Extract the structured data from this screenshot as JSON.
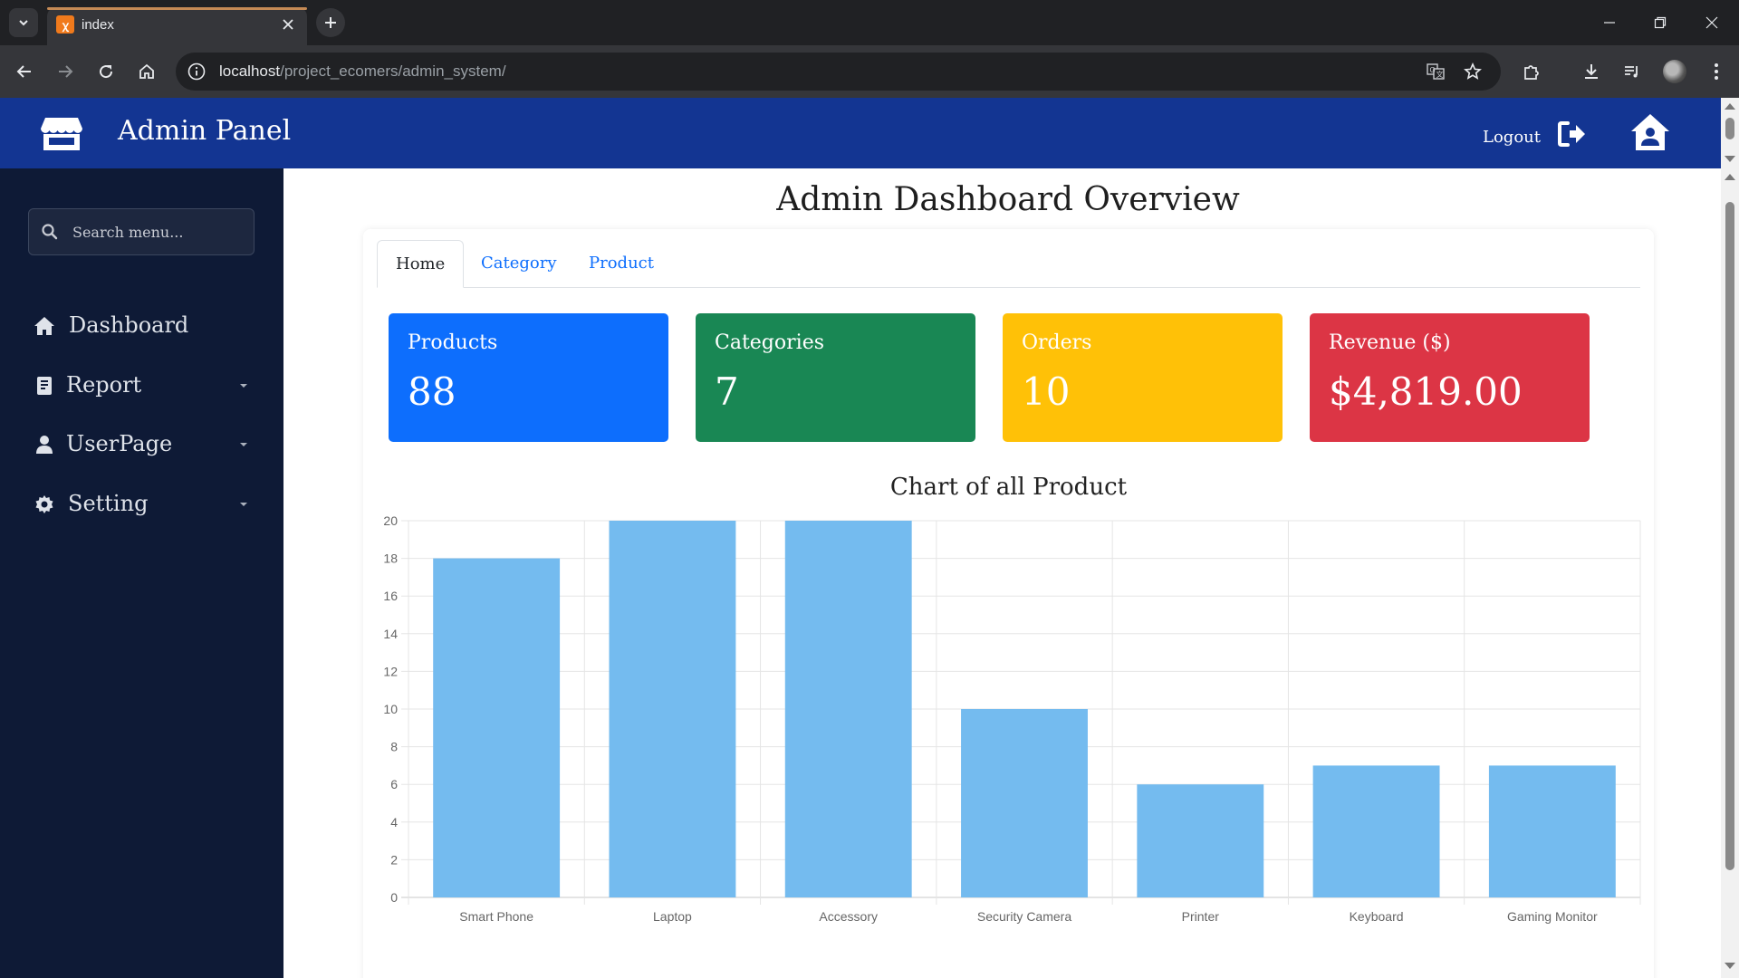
{
  "browser": {
    "tab_title": "index",
    "url_host": "localhost",
    "url_path": "/project_ecomers/admin_system/"
  },
  "header": {
    "brand": "Admin Panel",
    "logout_label": "Logout"
  },
  "sidebar": {
    "search_placeholder": "Search menu...",
    "items": [
      {
        "label": "Dashboard",
        "icon": "home-icon",
        "has_submenu": false
      },
      {
        "label": "Report",
        "icon": "report-icon",
        "has_submenu": true
      },
      {
        "label": "UserPage",
        "icon": "user-icon",
        "has_submenu": true
      },
      {
        "label": "Setting",
        "icon": "gear-icon",
        "has_submenu": true
      }
    ]
  },
  "main": {
    "title": "Admin Dashboard Overview",
    "tabs": [
      {
        "label": "Home",
        "active": true
      },
      {
        "label": "Category",
        "active": false
      },
      {
        "label": "Product",
        "active": false
      }
    ],
    "stats": [
      {
        "label": "Products",
        "value": "88",
        "color": "#0d6efd"
      },
      {
        "label": "Categories",
        "value": "7",
        "color": "#198754"
      },
      {
        "label": "Orders",
        "value": "10",
        "color": "#ffc107"
      },
      {
        "label": "Revenue ($)",
        "value": "$4,819.00",
        "color": "#dc3545"
      }
    ]
  },
  "chart_data": {
    "type": "bar",
    "title": "Chart of all Product",
    "categories": [
      "Smart Phone",
      "Laptop",
      "Accessory",
      "Security Camera",
      "Printer",
      "Keyboard",
      "Gaming Monitor"
    ],
    "values": [
      18,
      20,
      20,
      10,
      6,
      7,
      7
    ],
    "ylim": [
      0,
      20
    ],
    "yticks": [
      0,
      2,
      4,
      6,
      8,
      10,
      12,
      14,
      16,
      18,
      20
    ],
    "bar_color": "#74bbef",
    "grid": true
  },
  "colors": {
    "header_bg": "#133592",
    "sidebar_bg": "#0e1a36"
  }
}
